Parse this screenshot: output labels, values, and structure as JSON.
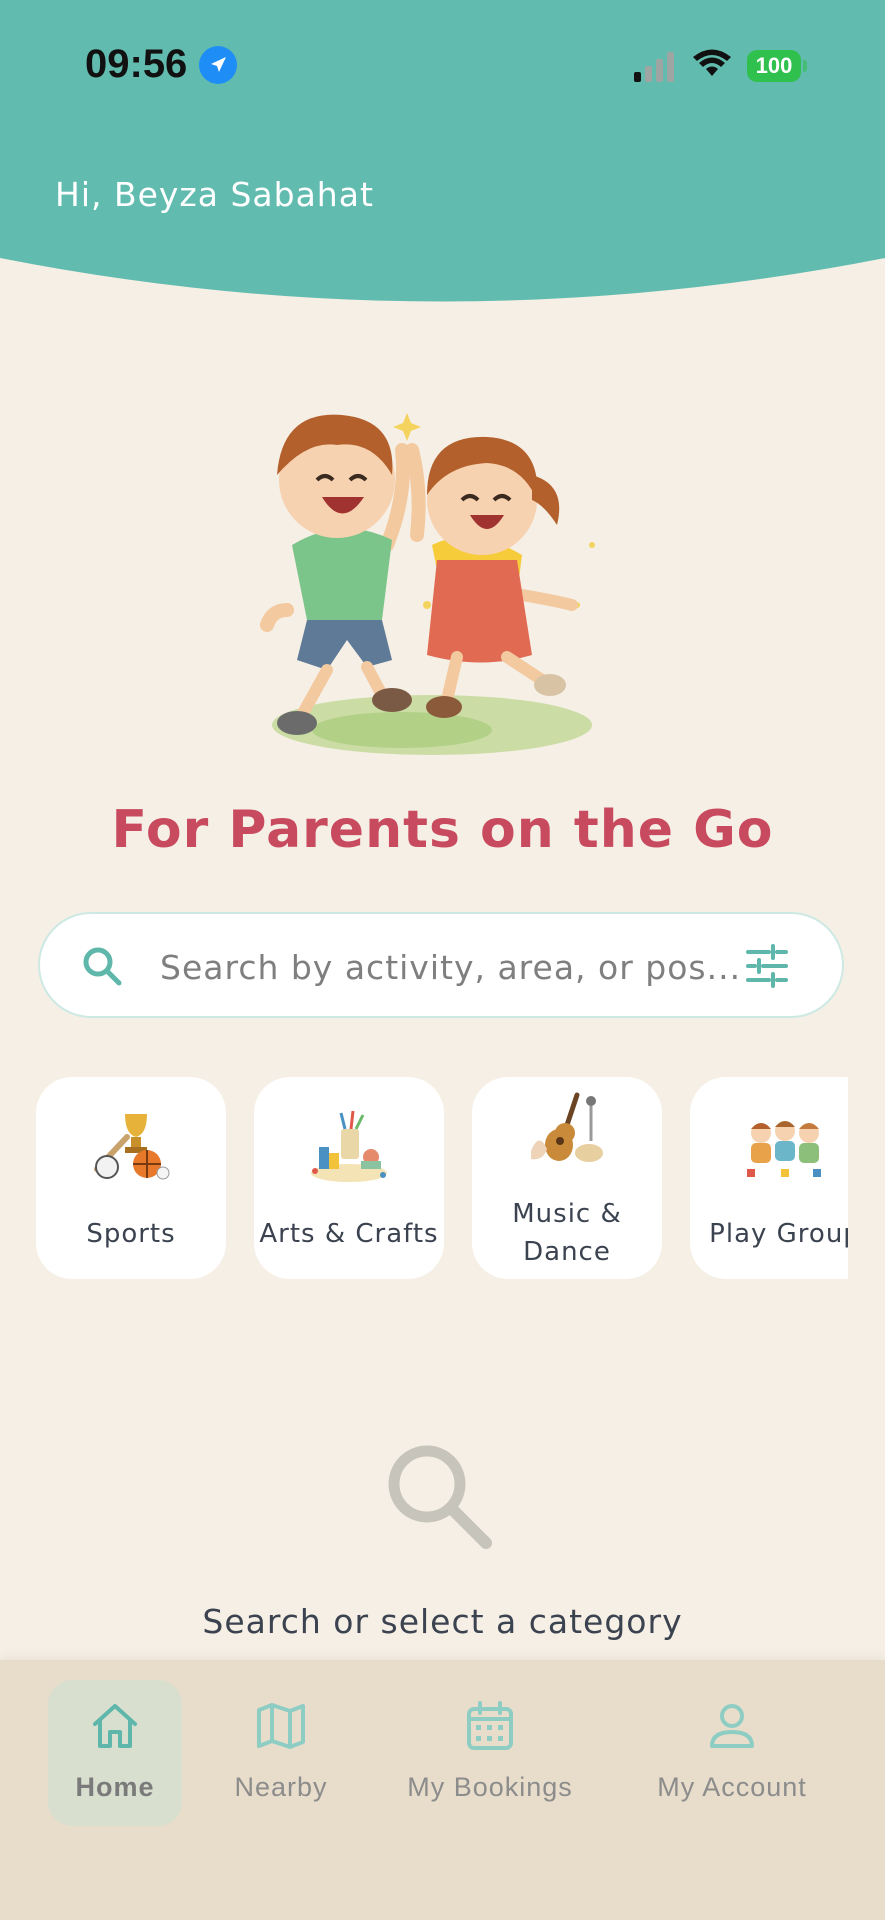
{
  "status_bar": {
    "time": "09:56",
    "battery": "100"
  },
  "header": {
    "greeting": "Hi, Beyza Sabahat"
  },
  "hero": {
    "tagline": "For Parents on the Go"
  },
  "search": {
    "placeholder": "Search by activity, area, or pos..."
  },
  "categories": [
    {
      "label": "Sports",
      "icon": "sports-equipment-icon"
    },
    {
      "label": "Arts & Crafts",
      "icon": "art-supplies-icon"
    },
    {
      "label": "Music & Dance",
      "icon": "guitar-icon"
    },
    {
      "label": "Play Group",
      "icon": "children-playing-icon"
    }
  ],
  "empty_state": {
    "text": "Search or select a category"
  },
  "bottom_nav": {
    "items": [
      {
        "label": "Home",
        "icon": "home-icon",
        "active": true
      },
      {
        "label": "Nearby",
        "icon": "map-icon",
        "active": false
      },
      {
        "label": "My Bookings",
        "icon": "calendar-icon",
        "active": false
      },
      {
        "label": "My Account",
        "icon": "person-icon",
        "active": false
      }
    ]
  },
  "colors": {
    "header_teal": "#61BCAF",
    "background": "#F6EFE5",
    "accent_red": "#C84A5F",
    "teal_icon": "#5EB7AA",
    "nav_bg": "#E8DDCA"
  }
}
